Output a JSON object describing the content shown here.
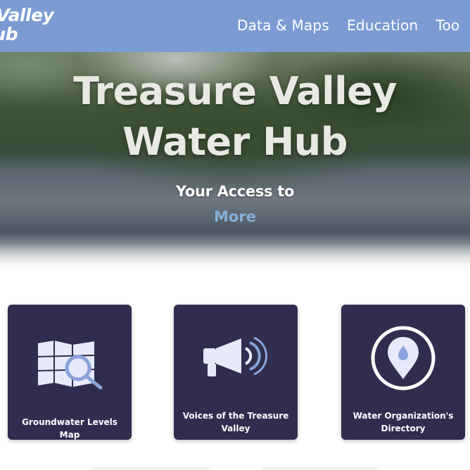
{
  "nav": {
    "brand_line1": "e Valley",
    "brand_line2": "Hub",
    "links": [
      "Data & Maps",
      "Education",
      "Too"
    ]
  },
  "hero": {
    "title_line1": "Treasure Valley",
    "title_line2": "Water Hub",
    "subtitle": "Your Access to",
    "rotating_word": "More"
  },
  "cards": [
    {
      "label": "Groundwater Levels Map",
      "icon": "map-search-icon"
    },
    {
      "label": "Voices of the Treasure Valley",
      "icon": "megaphone-icon"
    },
    {
      "label": "Water Organization's Directory",
      "icon": "location-pin-icon"
    }
  ],
  "colors": {
    "nav_bg": "#7b9bd2",
    "card_bg": "#302d4f",
    "icon_fill": "#e6eafb",
    "icon_accent": "#8aa2db"
  }
}
